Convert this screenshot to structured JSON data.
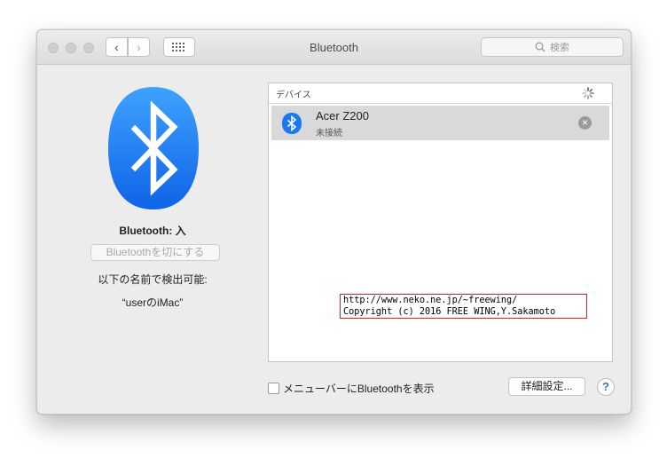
{
  "window": {
    "title": "Bluetooth"
  },
  "toolbar": {
    "back_glyph": "‹",
    "forward_glyph": "›",
    "search_placeholder": "検索"
  },
  "sidebar": {
    "status": "Bluetooth: 入",
    "toggle_button": "Bluetoothを切にする",
    "discoverable_label": "以下の名前で検出可能:",
    "computer_name": "“userのiMac”"
  },
  "devices": {
    "header": "デバイス",
    "items": [
      {
        "name": "Acer Z200",
        "status": "未接続"
      }
    ]
  },
  "watermark": {
    "line1": "http://www.neko.ne.jp/~freewing/",
    "line2": "Copyright (c) 2016 FREE WING,Y.Sakamoto"
  },
  "footer": {
    "menubar_checkbox_label": "メニューバーにBluetoothを表示",
    "menubar_checked": false,
    "advanced_button": "詳細設定...",
    "help_glyph": "?"
  },
  "colors": {
    "bluetooth_blue": "#1a78f0",
    "help_blue": "#2a7ad9",
    "watermark_border": "#e02020"
  }
}
